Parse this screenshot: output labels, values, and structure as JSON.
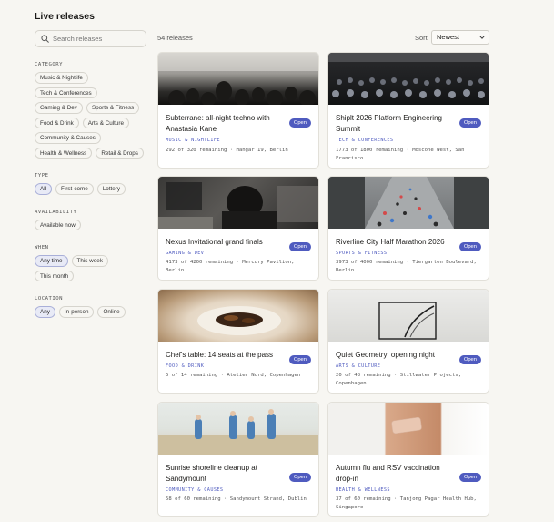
{
  "page": {
    "title": "Live releases"
  },
  "search": {
    "placeholder": "Search releases"
  },
  "filters": {
    "category": {
      "label": "CATEGORY",
      "options": [
        "Music & Nightlife",
        "Tech & Conferences",
        "Gaming & Dev",
        "Sports & Fitness",
        "Food & Drink",
        "Arts & Culture",
        "Community & Causes",
        "Health & Wellness",
        "Retail & Drops"
      ]
    },
    "type": {
      "label": "TYPE",
      "options": [
        "All",
        "First-come",
        "Lottery"
      ],
      "selected": "All"
    },
    "availability": {
      "label": "AVAILABILITY",
      "options": [
        "Available now"
      ]
    },
    "when": {
      "label": "WHEN",
      "options": [
        "Any time",
        "This week",
        "This month"
      ],
      "selected": "Any time"
    },
    "location": {
      "label": "LOCATION",
      "options": [
        "Any",
        "In-person",
        "Online"
      ],
      "selected": "Any"
    }
  },
  "results": {
    "count": "54 releases",
    "sort_label": "Sort",
    "sort_value": "Newest"
  },
  "cards": [
    {
      "title": "Subterrane: all-night techno with Anastasia Kane",
      "badge": "Open",
      "category": "MUSIC & NIGHTLIFE",
      "meta": "292 of 320 remaining · Hangar 19, Berlin"
    },
    {
      "title": "Shiplt 2026 Platform Engineering Summit",
      "badge": "Open",
      "category": "TECH & CONFERENCES",
      "meta": "1773 of 1800 remaining · Moscone West, San Francisco"
    },
    {
      "title": "Nexus Invitational grand finals",
      "badge": "Open",
      "category": "GAMING & DEV",
      "meta": "4173 of 4200 remaining · Mercury Pavilion, Berlin"
    },
    {
      "title": "Riverline City Half Marathon 2026",
      "badge": "Open",
      "category": "SPORTS & FITNESS",
      "meta": "3973 of 4000 remaining · Tiergarten Boulevard, Berlin"
    },
    {
      "title": "Chef's table: 14 seats at the pass",
      "badge": "Open",
      "category": "FOOD & DRINK",
      "meta": "5 of 14 remaining · Atelier Nord, Copenhagen"
    },
    {
      "title": "Quiet Geometry: opening night",
      "badge": "Open",
      "category": "ARTS & CULTURE",
      "meta": "20 of 48 remaining · Stillwater Projects, Copenhagen"
    },
    {
      "title": "Sunrise shoreline cleanup at Sandymount",
      "badge": "Open",
      "category": "COMMUNITY & CAUSES",
      "meta": "58 of 60 remaining · Sandymount Strand, Dublin"
    },
    {
      "title": "Autumn flu and RSV vaccination drop-in",
      "badge": "Open",
      "category": "HEALTH & WELLNESS",
      "meta": "37 of 60 remaining · Tanjong Pagar Health Hub, Singapore"
    }
  ],
  "colors": {
    "accent": "#4f5bbf",
    "background": "#f7f6f2",
    "card": "#ffffff",
    "chip_active": "#e8eaf6"
  }
}
